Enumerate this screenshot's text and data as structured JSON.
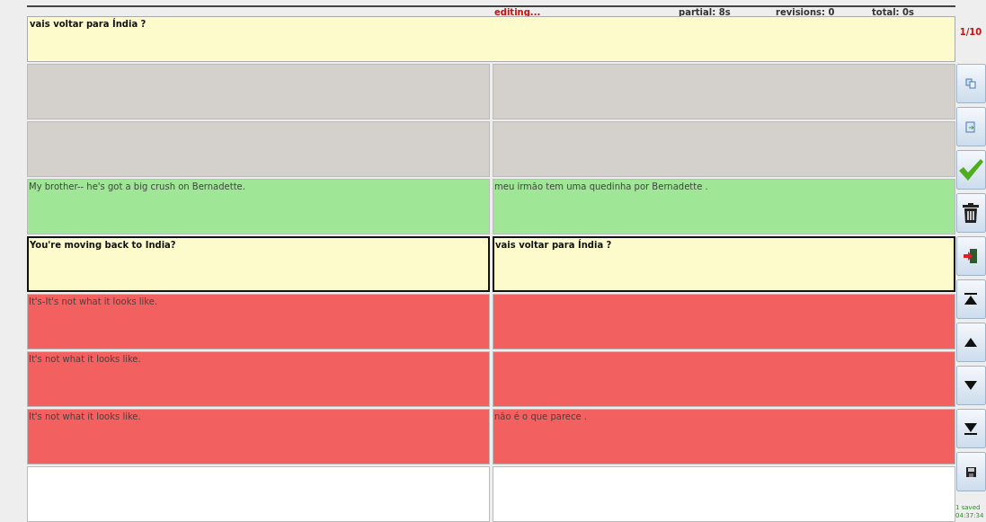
{
  "status_bar": {
    "state": "editing...",
    "partial": "partial: 8s",
    "revisions": "revisions: 0",
    "total": "total: 0s"
  },
  "editor": {
    "value": "vais voltar para Índia ?"
  },
  "counter": "1/10",
  "rows": [
    {
      "color": "#d4d0cb",
      "selected": false
    },
    {
      "color": "#d4d0cb",
      "selected": false
    },
    {
      "color": "#9fe696",
      "selected": false,
      "source": "My brother-- he's got a big crush on Bernadette.",
      "target": "meu irmão tem uma quedinha por Bernadette ."
    },
    {
      "color": "#fdfacb",
      "selected": true,
      "source": "You're moving back to India?",
      "target": "vais voltar para Índia ?"
    },
    {
      "color": "#f26060",
      "selected": false,
      "source": "It's-It's not what it looks like."
    },
    {
      "color": "#f26060",
      "selected": false,
      "source": "It's not what it looks like."
    },
    {
      "color": "#f26060",
      "selected": false,
      "source": "It's not what it looks like.",
      "target": "não é o que parece ."
    },
    {
      "color": "#ffffff",
      "selected": false
    }
  ],
  "tools": [
    {
      "kind": "copy"
    },
    {
      "kind": "paste"
    },
    {
      "kind": "accept"
    },
    {
      "kind": "delete"
    },
    {
      "kind": "exit"
    },
    {
      "kind": "first"
    },
    {
      "kind": "up"
    },
    {
      "kind": "down"
    },
    {
      "kind": "last"
    },
    {
      "kind": "save"
    }
  ],
  "saved": {
    "line1": "1 saved",
    "line2": "04:37:34"
  }
}
